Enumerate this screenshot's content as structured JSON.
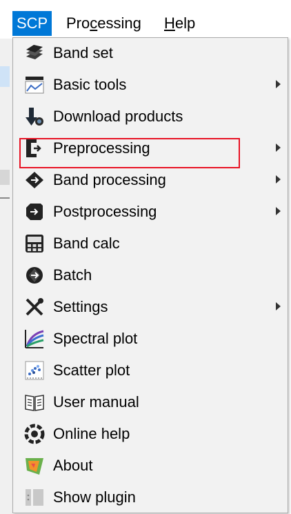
{
  "menubar": {
    "items": [
      {
        "label": "SCP",
        "active": true
      },
      {
        "label_pre": "Pro",
        "label_ul": "c",
        "label_post": "essing"
      },
      {
        "label_pre": "",
        "label_ul": "H",
        "label_post": "elp"
      }
    ]
  },
  "menu": {
    "items": [
      {
        "label": "Band set",
        "icon": "band-set-icon",
        "submenu": false
      },
      {
        "label": "Basic tools",
        "icon": "basic-tools-icon",
        "submenu": true
      },
      {
        "label": "Download products",
        "icon": "download-icon",
        "submenu": false,
        "highlighted": true
      },
      {
        "label": "Preprocessing",
        "icon": "preprocessing-icon",
        "submenu": true
      },
      {
        "label": "Band processing",
        "icon": "band-processing-icon",
        "submenu": true
      },
      {
        "label": "Postprocessing",
        "icon": "postprocessing-icon",
        "submenu": true
      },
      {
        "label": "Band calc",
        "icon": "band-calc-icon",
        "submenu": false
      },
      {
        "label": "Batch",
        "icon": "batch-icon",
        "submenu": false
      },
      {
        "label": "Settings",
        "icon": "settings-icon",
        "submenu": true
      },
      {
        "label": "Spectral plot",
        "icon": "spectral-plot-icon",
        "submenu": false
      },
      {
        "label": "Scatter plot",
        "icon": "scatter-plot-icon",
        "submenu": false
      },
      {
        "label": "User manual",
        "icon": "user-manual-icon",
        "submenu": false
      },
      {
        "label": "Online help",
        "icon": "online-help-icon",
        "submenu": false
      },
      {
        "label": "About",
        "icon": "about-icon",
        "submenu": false
      },
      {
        "label": "Show plugin",
        "icon": "show-plugin-icon",
        "submenu": false
      }
    ]
  },
  "colors": {
    "menubar_active": "#0078d7",
    "highlight_border": "#e81123",
    "menu_bg": "#f2f2f2"
  }
}
